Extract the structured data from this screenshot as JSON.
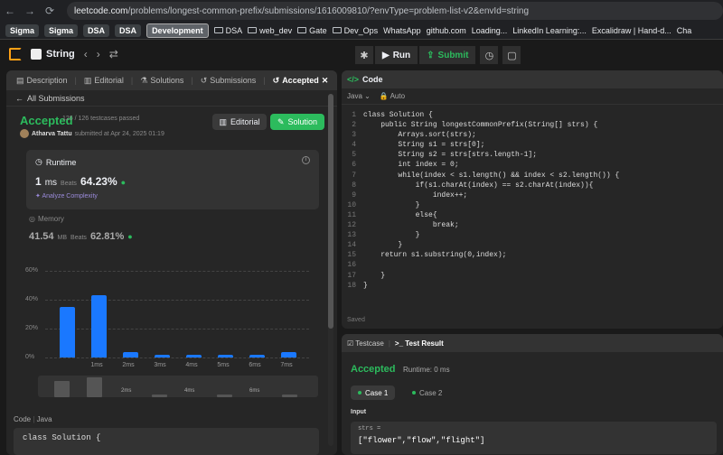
{
  "browser": {
    "url_host": "leetcode.com",
    "url_path": "/problems/longest-common-prefix/submissions/1616009810/?envType=problem-list-v2&envId=string",
    "bookmarks": [
      "Sigma",
      "Sigma",
      "DSA",
      "DSA",
      "Development",
      "DSA",
      "web_dev",
      "Gate",
      "Dev_Ops",
      "WhatsApp",
      "github.com",
      "Loading...",
      "LinkedIn Learning:...",
      "Excalidraw | Hand-d...",
      "Cha"
    ]
  },
  "topbar": {
    "list_label": "String",
    "run_label": "Run",
    "submit_label": "Submit"
  },
  "left": {
    "tabs": [
      "Description",
      "Editorial",
      "Solutions",
      "Submissions",
      "Accepted"
    ],
    "back_label": "All Submissions",
    "status": "Accepted",
    "testcases": "126 / 126 testcases passed",
    "author": "Atharva Tattu",
    "submitted": "submitted at Apr 24, 2025 01:19",
    "editorial_btn": "Editorial",
    "solution_btn": "Solution",
    "runtime_label": "Runtime",
    "runtime_value": "1",
    "runtime_unit": "ms",
    "beats_label": "Beats",
    "runtime_beats": "64.23%",
    "analyze": "Analyze Complexity",
    "memory_label": "Memory",
    "memory_value": "41.54",
    "memory_unit": "MB",
    "memory_beats": "62.81%",
    "code_label": "Code",
    "code_lang": "Java",
    "snippet_line": "class Solution {"
  },
  "chart_data": {
    "type": "bar",
    "ylabels": [
      "60%",
      "40%",
      "20%",
      "0%"
    ],
    "ylim": [
      0,
      60
    ],
    "xlabels": [
      "1ms",
      "2ms",
      "3ms",
      "4ms",
      "5ms",
      "6ms",
      "7ms"
    ],
    "values": [
      35,
      43,
      4,
      2,
      2,
      2,
      2,
      4
    ],
    "minimap_labels": [
      "2ms",
      "4ms",
      "6ms"
    ]
  },
  "editor": {
    "title": "Code",
    "lang": "Java",
    "mode": "Auto",
    "saved": "Saved",
    "lines": [
      "class Solution {",
      "    public String longestCommonPrefix(String[] strs) {",
      "        Arrays.sort(strs);",
      "        String s1 = strs[0];",
      "        String s2 = strs[strs.length-1];",
      "        int index = 0;",
      "        while(index < s1.length() && index < s2.length()) {",
      "            if(s1.charAt(index) == s2.charAt(index)){",
      "                index++;",
      "            }",
      "            else{",
      "                break;",
      "            }",
      "        }",
      "    return s1.substring(0,index);",
      "",
      "    }",
      "}"
    ]
  },
  "testpanel": {
    "testcase_tab": "Testcase",
    "result_tab": "Test Result",
    "status": "Accepted",
    "runtime": "Runtime: 0 ms",
    "case1": "Case 1",
    "case2": "Case 2",
    "input_label": "Input",
    "var_name": "strs =",
    "var_value": "[\"flower\",\"flow\",\"flight\"]"
  }
}
